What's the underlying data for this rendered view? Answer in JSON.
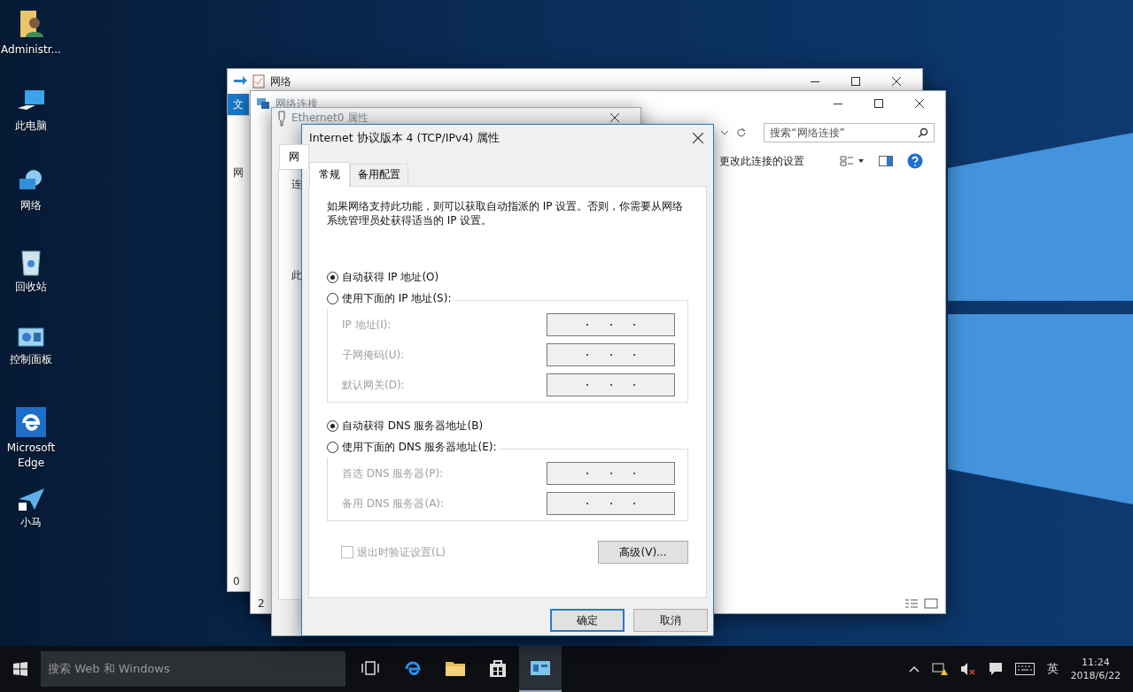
{
  "desktop": {
    "icons": [
      {
        "label": "Administr...",
        "kind": "user"
      },
      {
        "label": "此电脑",
        "kind": "pc"
      },
      {
        "label": "网络",
        "kind": "network"
      },
      {
        "label": "回收站",
        "kind": "bin"
      },
      {
        "label": "控制面板",
        "kind": "panel"
      },
      {
        "label": "Microsoft Edge",
        "kind": "edge"
      },
      {
        "label": "小马",
        "kind": "plane"
      }
    ]
  },
  "network_window": {
    "title": "网络",
    "ribbon_tab": "文",
    "fragments": [
      "网",
      "0"
    ]
  },
  "connections_window": {
    "title": "网络连接",
    "search": {
      "placeholder": "搜索“网络连接”"
    },
    "command": "更改此连接的设置",
    "fragment": "2"
  },
  "ethernet_window": {
    "title": "Ethernet0 属性",
    "tab": "网",
    "fragments": [
      "连",
      "此"
    ]
  },
  "dialog": {
    "title": "Internet 协议版本 4 (TCP/IPv4) 属性",
    "tabs": [
      {
        "label": "常规",
        "selected": true
      },
      {
        "label": "备用配置",
        "selected": false
      }
    ],
    "description": "如果网络支持此功能，则可以获取自动指派的 IP 设置。否则，你需要从网络系统管理员处获得适当的 IP 设置。",
    "ip_options": [
      {
        "label": "自动获得 IP 地址(O)",
        "selected": true
      },
      {
        "label": "使用下面的 IP 地址(S):",
        "selected": false
      }
    ],
    "ip_fields": [
      {
        "label": "IP 地址(I):",
        "disabled": true
      },
      {
        "label": "子网掩码(U):",
        "disabled": true
      },
      {
        "label": "默认网关(D):",
        "disabled": true
      }
    ],
    "dns_options": [
      {
        "label": "自动获得 DNS 服务器地址(B)",
        "selected": true
      },
      {
        "label": "使用下面的 DNS 服务器地址(E):",
        "selected": false
      }
    ],
    "dns_fields": [
      {
        "label": "首选 DNS 服务器(P):",
        "disabled": true
      },
      {
        "label": "备用 DNS 服务器(A):",
        "disabled": true
      }
    ],
    "validate": {
      "label": "退出时验证设置(L)",
      "checked": false,
      "disabled": true
    },
    "advanced_button": "高级(V)...",
    "buttons": [
      {
        "label": "确定",
        "default": true
      },
      {
        "label": "取消",
        "default": false
      }
    ]
  },
  "taskbar": {
    "search": {
      "placeholder": "搜索 Web 和 Windows"
    },
    "apps": [
      {
        "kind": "taskview",
        "active": false
      },
      {
        "kind": "edge",
        "active": false
      },
      {
        "kind": "explorer",
        "active": false
      },
      {
        "kind": "store",
        "active": false
      },
      {
        "kind": "panel",
        "active": true
      }
    ],
    "ime": "英",
    "time": "11:24",
    "date": "2018/6/22"
  }
}
